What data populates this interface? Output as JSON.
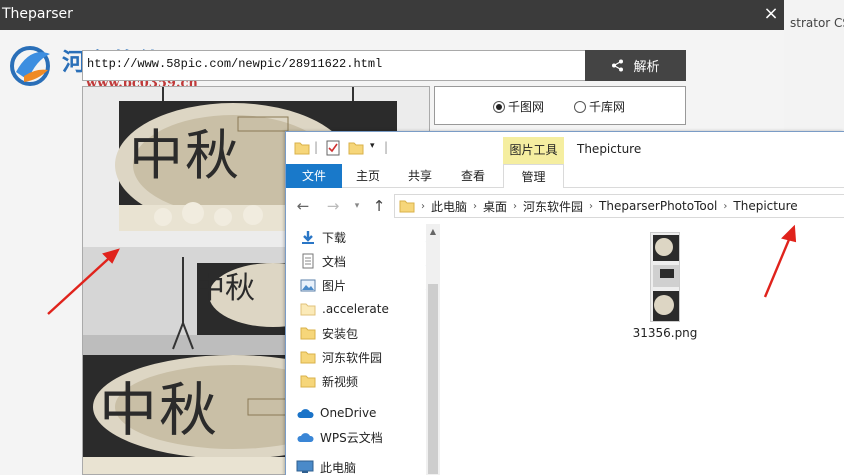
{
  "background": {
    "right_text": "strator CS"
  },
  "app": {
    "title": "Theparser",
    "close_glyph": "×",
    "watermark_text": "河东软件园",
    "watermark_url": "www.pc0359.cn",
    "url_value": "http://www.58pic.com/newpic/28911622.html",
    "parse_label": "解析",
    "sites": [
      {
        "label": "千图网",
        "checked": true
      },
      {
        "label": "千库网",
        "checked": false
      }
    ],
    "poster_lines": [
      "中",
      "秋"
    ]
  },
  "explorer": {
    "window_title": "Thepicture",
    "ribbon": {
      "file_tab": "文件",
      "tabs": [
        "主页",
        "共享",
        "查看"
      ],
      "context_group": "图片工具",
      "context_tab": "管理"
    },
    "breadcrumb": [
      "此电脑",
      "桌面",
      "河东软件园",
      "TheparserPhotoTool",
      "Thepicture"
    ],
    "nav_items": [
      {
        "label": "下载",
        "icon": "download-icon",
        "pinned": true
      },
      {
        "label": "文档",
        "icon": "document-icon",
        "pinned": true
      },
      {
        "label": "图片",
        "icon": "picture-icon",
        "pinned": true
      },
      {
        "label": ".accelerate",
        "icon": "folder-icon",
        "pinned": false
      },
      {
        "label": "安装包",
        "icon": "folder-icon",
        "pinned": false
      },
      {
        "label": "河东软件园",
        "icon": "folder-icon",
        "pinned": false
      },
      {
        "label": "新视频",
        "icon": "folder-icon",
        "pinned": false
      },
      {
        "label": "OneDrive",
        "icon": "cloud-icon",
        "pinned": false
      },
      {
        "label": "WPS云文档",
        "icon": "cloud-icon",
        "pinned": false
      },
      {
        "label": "此电脑",
        "icon": "computer-icon",
        "pinned": false
      }
    ],
    "files": [
      {
        "name": "31356.png"
      }
    ]
  },
  "colors": {
    "accent": "#1979ca",
    "titlebar": "#3b3b3b",
    "button": "#444444",
    "tool_tab": "#f5eea0",
    "arrow": "#e0231c"
  }
}
